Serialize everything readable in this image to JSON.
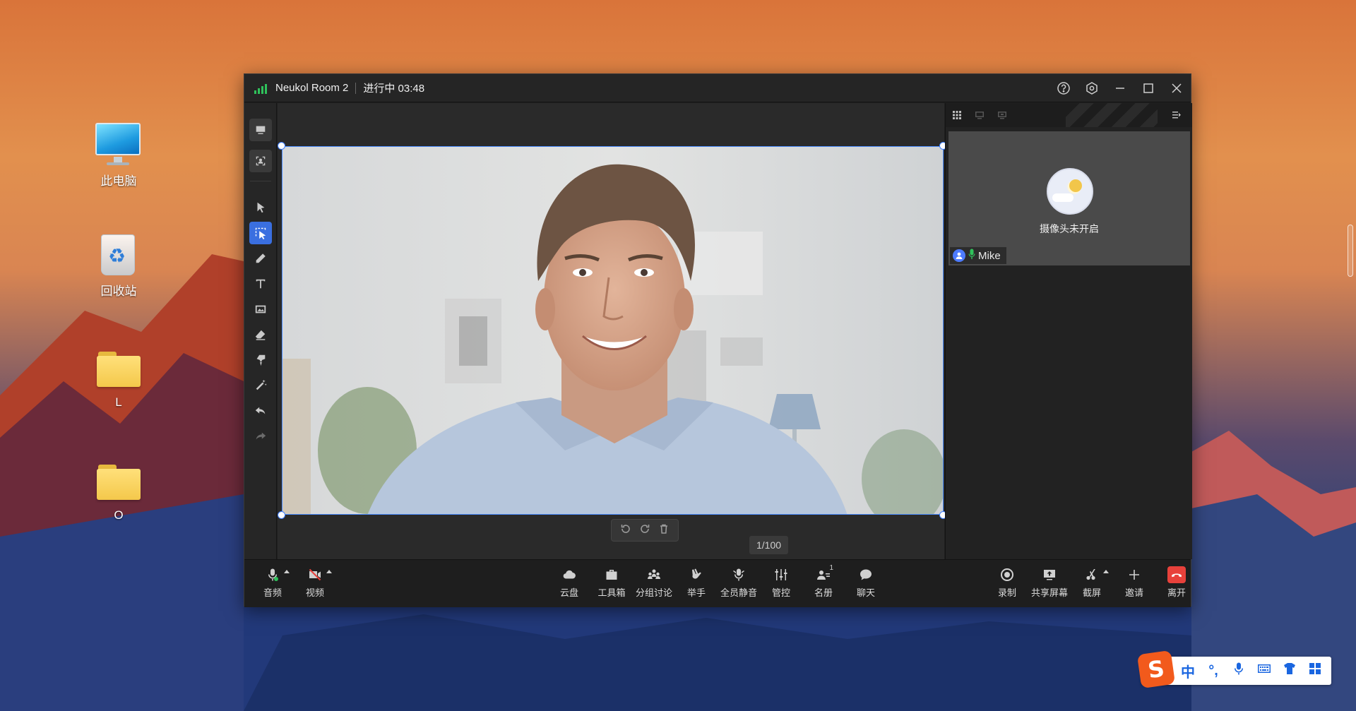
{
  "desktop": {
    "icons": [
      {
        "label": "此电脑",
        "kind": "computer"
      },
      {
        "label": "回收站",
        "kind": "recycle-bin"
      },
      {
        "label": "L",
        "kind": "folder"
      },
      {
        "label": "O",
        "kind": "folder"
      }
    ]
  },
  "window": {
    "room_name": "Neukol Room 2",
    "status": "进行中 03:48",
    "signal_color": "#2fc25b",
    "controls": [
      "help-icon",
      "settings-icon",
      "minimize-icon",
      "maximize-icon",
      "close-icon"
    ]
  },
  "toolbar_left": {
    "tools": [
      "whiteboard-icon",
      "portrait-icon",
      "pointer-icon",
      "box-select-icon",
      "pen-icon",
      "text-icon",
      "image-icon",
      "eraser-icon",
      "brush-icon",
      "magic-wand-icon",
      "undo-icon",
      "redo-icon"
    ],
    "active_tool": "box-select-icon"
  },
  "stage": {
    "page_indicator": "1/100",
    "video_controls": [
      "rotate-left-icon",
      "rotate-right-icon",
      "delete-icon"
    ]
  },
  "participants": {
    "header_icons": [
      "grid-view-icon",
      "speaker-view-icon",
      "share-view-icon",
      "collapse-panel-icon"
    ],
    "tiles": [
      {
        "name": "Mike",
        "camera_status": "摄像头未开启",
        "mic": "on",
        "mic_color": "#2fc25b"
      }
    ]
  },
  "bottom_bar": {
    "left": [
      {
        "label": "音频",
        "icon": "mic-icon"
      },
      {
        "label": "视频",
        "icon": "camera-off-icon"
      }
    ],
    "center": [
      {
        "label": "云盘",
        "icon": "cloud-icon"
      },
      {
        "label": "工具箱",
        "icon": "toolbox-icon"
      },
      {
        "label": "分组讨论",
        "icon": "breakout-icon"
      },
      {
        "label": "举手",
        "icon": "raise-hand-icon"
      },
      {
        "label": "全员静音",
        "icon": "mute-all-icon"
      },
      {
        "label": "管控",
        "icon": "controls-icon"
      },
      {
        "label": "名册",
        "icon": "roster-icon",
        "badge": "1"
      },
      {
        "label": "聊天",
        "icon": "chat-icon"
      }
    ],
    "right": [
      {
        "label": "录制",
        "icon": "record-icon"
      },
      {
        "label": "共享屏幕",
        "icon": "share-screen-icon"
      },
      {
        "label": "截屏",
        "icon": "screenshot-icon"
      },
      {
        "label": "邀请",
        "icon": "invite-icon"
      },
      {
        "label": "离开",
        "icon": "leave-icon",
        "color": "#e8413b"
      }
    ]
  },
  "ime": {
    "logo": "S",
    "mode": "中",
    "punct": "°,",
    "items": [
      "voice-icon",
      "keyboard-icon",
      "skin-icon",
      "toolbox-grid-icon"
    ],
    "brand_color": "#f25a1c",
    "accent_color": "#1a66e0"
  }
}
